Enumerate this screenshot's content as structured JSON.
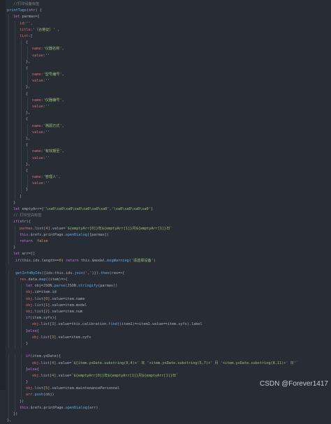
{
  "colors": {
    "background": "#282c34",
    "comment": "#7f848e",
    "keyword": "#c678dd",
    "string": "#98c379",
    "function": "#61afef",
    "property": "#e06c75",
    "number": "#d19a66",
    "plain": "#abb2bf",
    "class": "#e5c07b"
  },
  "code_lines": [
    {
      "indent": 1,
      "segments": [
        {
          "t": "//打印设备标签",
          "c": "comment"
        }
      ]
    },
    {
      "indent": 0,
      "segments": [
        {
          "t": "printTags",
          "c": "function"
        },
        {
          "t": "(str) {",
          "c": "plain"
        }
      ]
    },
    {
      "indent": 1,
      "segments": [
        {
          "t": "let",
          "c": "keyword"
        },
        {
          "t": " parmas={",
          "c": "plain"
        }
      ]
    },
    {
      "indent": 2,
      "segments": [
        {
          "t": "id",
          "c": "property"
        },
        {
          "t": ":",
          "c": "plain"
        },
        {
          "t": "''",
          "c": "string"
        },
        {
          "t": ",",
          "c": "plain"
        }
      ]
    },
    {
      "indent": 2,
      "segments": [
        {
          "t": "title",
          "c": "property"
        },
        {
          "t": ":",
          "c": "plain"
        },
        {
          "t": "'（合格证）'",
          "c": "string"
        },
        {
          "t": " ,",
          "c": "plain"
        }
      ]
    },
    {
      "indent": 2,
      "segments": [
        {
          "t": "list",
          "c": "property"
        },
        {
          "t": ":[",
          "c": "plain"
        }
      ]
    },
    {
      "indent": 3,
      "segments": [
        {
          "t": "{",
          "c": "plain"
        }
      ]
    },
    {
      "indent": 4,
      "segments": [
        {
          "t": "name",
          "c": "property"
        },
        {
          "t": ":",
          "c": "plain"
        },
        {
          "t": "'仪器名称'",
          "c": "string"
        },
        {
          "t": ",",
          "c": "plain"
        }
      ]
    },
    {
      "indent": 4,
      "segments": [
        {
          "t": "value",
          "c": "property"
        },
        {
          "t": ":",
          "c": "plain"
        },
        {
          "t": "''",
          "c": "string"
        }
      ]
    },
    {
      "indent": 3,
      "segments": [
        {
          "t": "},",
          "c": "plain"
        }
      ]
    },
    {
      "indent": 3,
      "segments": [
        {
          "t": "{",
          "c": "plain"
        }
      ]
    },
    {
      "indent": 4,
      "segments": [
        {
          "t": "name",
          "c": "property"
        },
        {
          "t": ":",
          "c": "plain"
        },
        {
          "t": "'型号编号'",
          "c": "string"
        },
        {
          "t": ",",
          "c": "plain"
        }
      ]
    },
    {
      "indent": 4,
      "segments": [
        {
          "t": "value",
          "c": "property"
        },
        {
          "t": ":",
          "c": "plain"
        },
        {
          "t": "''",
          "c": "string"
        }
      ]
    },
    {
      "indent": 3,
      "segments": [
        {
          "t": "},",
          "c": "plain"
        }
      ]
    },
    {
      "indent": 3,
      "segments": [
        {
          "t": "{",
          "c": "plain"
        }
      ]
    },
    {
      "indent": 4,
      "segments": [
        {
          "t": "name",
          "c": "property"
        },
        {
          "t": ":",
          "c": "plain"
        },
        {
          "t": "'仪器编号'",
          "c": "string"
        },
        {
          "t": ",",
          "c": "plain"
        }
      ]
    },
    {
      "indent": 4,
      "segments": [
        {
          "t": "value",
          "c": "property"
        },
        {
          "t": ":",
          "c": "plain"
        },
        {
          "t": "''",
          "c": "string"
        }
      ]
    },
    {
      "indent": 3,
      "segments": [
        {
          "t": "},",
          "c": "plain"
        }
      ]
    },
    {
      "indent": 3,
      "segments": [
        {
          "t": "{",
          "c": "plain"
        }
      ]
    },
    {
      "indent": 4,
      "segments": [
        {
          "t": "name",
          "c": "property"
        },
        {
          "t": ":",
          "c": "plain"
        },
        {
          "t": "'溯源方式'",
          "c": "string"
        },
        {
          "t": ",",
          "c": "plain"
        }
      ]
    },
    {
      "indent": 4,
      "segments": [
        {
          "t": "value",
          "c": "property"
        },
        {
          "t": ":",
          "c": "plain"
        },
        {
          "t": "''",
          "c": "string"
        }
      ]
    },
    {
      "indent": 3,
      "segments": [
        {
          "t": "},",
          "c": "plain"
        }
      ]
    },
    {
      "indent": 3,
      "segments": [
        {
          "t": "{",
          "c": "plain"
        }
      ]
    },
    {
      "indent": 4,
      "segments": [
        {
          "t": "name",
          "c": "property"
        },
        {
          "t": ":",
          "c": "plain"
        },
        {
          "t": "'有效期至'",
          "c": "string"
        },
        {
          "t": ",",
          "c": "plain"
        }
      ]
    },
    {
      "indent": 4,
      "segments": [
        {
          "t": "value",
          "c": "property"
        },
        {
          "t": ":",
          "c": "plain"
        },
        {
          "t": "''",
          "c": "string"
        }
      ]
    },
    {
      "indent": 3,
      "segments": [
        {
          "t": "},",
          "c": "plain"
        }
      ]
    },
    {
      "indent": 3,
      "segments": [
        {
          "t": "{",
          "c": "plain"
        }
      ]
    },
    {
      "indent": 4,
      "segments": [
        {
          "t": "name",
          "c": "property"
        },
        {
          "t": ":",
          "c": "plain"
        },
        {
          "t": "'管理人'",
          "c": "string"
        },
        {
          "t": ",",
          "c": "plain"
        }
      ]
    },
    {
      "indent": 4,
      "segments": [
        {
          "t": "value",
          "c": "property"
        },
        {
          "t": ":",
          "c": "plain"
        },
        {
          "t": "''",
          "c": "string"
        }
      ]
    },
    {
      "indent": 3,
      "segments": [
        {
          "t": "}",
          "c": "plain"
        }
      ]
    },
    {
      "indent": 2,
      "segments": [
        {
          "t": "]",
          "c": "plain"
        }
      ]
    },
    {
      "indent": 1,
      "segments": [
        {
          "t": "}",
          "c": "plain"
        }
      ]
    },
    {
      "indent": 1,
      "segments": [
        {
          "t": "let",
          "c": "keyword"
        },
        {
          "t": " emptyArr=[",
          "c": "plain"
        },
        {
          "t": "'\\xa0\\xa0\\xa0\\xa0\\xa0\\xa0\\xa0'",
          "c": "string"
        },
        {
          "t": ",",
          "c": "plain"
        },
        {
          "t": "'\\xa0\\xa0\\xa0\\xa0'",
          "c": "string"
        },
        {
          "t": "]",
          "c": "plain"
        }
      ]
    },
    {
      "indent": 1,
      "segments": [
        {
          "t": "// 打印空白标签",
          "c": "comment"
        }
      ]
    },
    {
      "indent": 1,
      "segments": [
        {
          "t": "if",
          "c": "keyword"
        },
        {
          "t": "(str){",
          "c": "plain"
        }
      ]
    },
    {
      "indent": 2,
      "segments": [
        {
          "t": "parmas",
          "c": "property"
        },
        {
          "t": ".list[",
          "c": "plain"
        },
        {
          "t": "4",
          "c": "number"
        },
        {
          "t": "].value=",
          "c": "plain"
        },
        {
          "t": "`${emptyArr[0]}年${emptyArr[1]}月${emptyArr[1]}日`",
          "c": "string"
        }
      ]
    },
    {
      "indent": 2,
      "segments": [
        {
          "t": "this",
          "c": "keyword"
        },
        {
          "t": ".$refs.printPage.",
          "c": "plain"
        },
        {
          "t": "openDialog",
          "c": "function"
        },
        {
          "t": "([parmas])",
          "c": "plain"
        }
      ]
    },
    {
      "indent": 2,
      "segments": [
        {
          "t": "return",
          "c": "keyword"
        },
        {
          "t": "  ",
          "c": "plain"
        },
        {
          "t": "false",
          "c": "number"
        }
      ]
    },
    {
      "indent": 1,
      "segments": [
        {
          "t": "}",
          "c": "plain"
        }
      ]
    },
    {
      "indent": 1,
      "segments": [
        {
          "t": "let",
          "c": "keyword"
        },
        {
          "t": " arr=[]",
          "c": "plain"
        }
      ]
    },
    {
      "indent": 1,
      "segments": [
        {
          "t": " if",
          "c": "keyword"
        },
        {
          "t": "(this.ids.length==",
          "c": "plain"
        },
        {
          "t": "0",
          "c": "number"
        },
        {
          "t": ") ",
          "c": "plain"
        },
        {
          "t": "return",
          "c": "keyword"
        },
        {
          "t": " this.$modal.",
          "c": "plain"
        },
        {
          "t": "msgWarning",
          "c": "function"
        },
        {
          "t": "(",
          "c": "plain"
        },
        {
          "t": "'请选择设备'",
          "c": "string"
        },
        {
          "t": ")",
          "c": "plain"
        }
      ]
    },
    {
      "indent": 0,
      "segments": [
        {
          "t": " ",
          "c": "plain"
        }
      ]
    },
    {
      "indent": 1,
      "segments": [
        {
          "t": " getInfoByIds",
          "c": "function"
        },
        {
          "t": "({ids:this.ids.",
          "c": "plain"
        },
        {
          "t": "join",
          "c": "function"
        },
        {
          "t": "(',')}).",
          "c": "plain"
        },
        {
          "t": "then",
          "c": "function"
        },
        {
          "t": "(res=>{",
          "c": "plain"
        }
      ]
    },
    {
      "indent": 2,
      "segments": [
        {
          "t": "res",
          "c": "property"
        },
        {
          "t": ".data.",
          "c": "plain"
        },
        {
          "t": "map",
          "c": "function"
        },
        {
          "t": "((item)=>{",
          "c": "plain"
        }
      ]
    },
    {
      "indent": 3,
      "segments": [
        {
          "t": "let",
          "c": "keyword"
        },
        {
          "t": " obj=JSON.",
          "c": "plain"
        },
        {
          "t": "parse",
          "c": "function"
        },
        {
          "t": "(JSON.",
          "c": "plain"
        },
        {
          "t": "stringify",
          "c": "function"
        },
        {
          "t": "(parmas))",
          "c": "plain"
        }
      ]
    },
    {
      "indent": 3,
      "segments": [
        {
          "t": "obj",
          "c": "property"
        },
        {
          "t": ".id=item.id",
          "c": "plain"
        }
      ]
    },
    {
      "indent": 3,
      "segments": [
        {
          "t": "obj",
          "c": "property"
        },
        {
          "t": ".list[",
          "c": "plain"
        },
        {
          "t": "0",
          "c": "number"
        },
        {
          "t": "].value=item.name",
          "c": "plain"
        }
      ]
    },
    {
      "indent": 3,
      "segments": [
        {
          "t": "obj",
          "c": "property"
        },
        {
          "t": ".list[",
          "c": "plain"
        },
        {
          "t": "1",
          "c": "number"
        },
        {
          "t": "].value=item.model",
          "c": "plain"
        }
      ]
    },
    {
      "indent": 3,
      "segments": [
        {
          "t": "obj",
          "c": "property"
        },
        {
          "t": ".list[",
          "c": "plain"
        },
        {
          "t": "2",
          "c": "number"
        },
        {
          "t": "].value=item.num",
          "c": "plain"
        }
      ]
    },
    {
      "indent": 3,
      "segments": [
        {
          "t": "if",
          "c": "keyword"
        },
        {
          "t": "(item.syfs){",
          "c": "plain"
        }
      ]
    },
    {
      "indent": 4,
      "segments": [
        {
          "t": "obj",
          "c": "property"
        },
        {
          "t": ".list[",
          "c": "plain"
        },
        {
          "t": "3",
          "c": "number"
        },
        {
          "t": "].value=this.calibration.",
          "c": "plain"
        },
        {
          "t": "find",
          "c": "function"
        },
        {
          "t": "((item1)=>item1.value==item.syfs).label",
          "c": "plain"
        }
      ]
    },
    {
      "indent": 3,
      "segments": [
        {
          "t": "}",
          "c": "plain"
        },
        {
          "t": "else",
          "c": "keyword"
        },
        {
          "t": "{",
          "c": "plain"
        }
      ]
    },
    {
      "indent": 4,
      "segments": [
        {
          "t": "obj",
          "c": "property"
        },
        {
          "t": ".list[",
          "c": "plain"
        },
        {
          "t": "3",
          "c": "number"
        },
        {
          "t": "].value=item.syfs",
          "c": "plain"
        }
      ]
    },
    {
      "indent": 3,
      "segments": [
        {
          "t": "}",
          "c": "plain"
        }
      ]
    },
    {
      "indent": 0,
      "segments": [
        {
          "t": " ",
          "c": "plain"
        }
      ]
    },
    {
      "indent": 3,
      "segments": [
        {
          "t": "if",
          "c": "keyword"
        },
        {
          "t": "(item.yxDate){",
          "c": "plain"
        }
      ]
    },
    {
      "indent": 4,
      "segments": [
        {
          "t": "obj",
          "c": "property"
        },
        {
          "t": ".list[",
          "c": "plain"
        },
        {
          "t": "4",
          "c": "number"
        },
        {
          "t": "].value=",
          "c": "plain"
        },
        {
          "t": "`${item.yxDate.substring(0,4)+' 年 '+item.yxDate.substring(5,7)+' 月 '+item.yxDate.substring(8,11)+' 日'`",
          "c": "string"
        }
      ]
    },
    {
      "indent": 3,
      "segments": [
        {
          "t": "}",
          "c": "plain"
        },
        {
          "t": "else",
          "c": "keyword"
        },
        {
          "t": "{",
          "c": "plain"
        }
      ]
    },
    {
      "indent": 4,
      "segments": [
        {
          "t": "obj",
          "c": "property"
        },
        {
          "t": ".list[",
          "c": "plain"
        },
        {
          "t": "4",
          "c": "number"
        },
        {
          "t": "].value=",
          "c": "plain"
        },
        {
          "t": "`${emptyArr[0]}年${emptyArr[1]}月${emptyArr[1]}日`",
          "c": "string"
        }
      ]
    },
    {
      "indent": 3,
      "segments": [
        {
          "t": "}",
          "c": "plain"
        }
      ]
    },
    {
      "indent": 3,
      "segments": [
        {
          "t": "obj",
          "c": "property"
        },
        {
          "t": ".list[",
          "c": "plain"
        },
        {
          "t": "5",
          "c": "number"
        },
        {
          "t": "].value=item.maintenancePersonnel",
          "c": "plain"
        }
      ]
    },
    {
      "indent": 3,
      "segments": [
        {
          "t": "arr",
          "c": "property"
        },
        {
          "t": ".",
          "c": "plain"
        },
        {
          "t": "push",
          "c": "function"
        },
        {
          "t": "(obj)",
          "c": "plain"
        }
      ]
    },
    {
      "indent": 2,
      "segments": [
        {
          "t": "})",
          "c": "plain"
        }
      ]
    },
    {
      "indent": 2,
      "segments": [
        {
          "t": "this",
          "c": "keyword"
        },
        {
          "t": ".$refs.printPage.",
          "c": "plain"
        },
        {
          "t": "openDialog",
          "c": "function"
        },
        {
          "t": "(arr)",
          "c": "plain"
        }
      ]
    },
    {
      "indent": 1,
      "segments": [
        {
          "t": "})",
          "c": "plain"
        }
      ]
    },
    {
      "indent": 0,
      "segments": [
        {
          "t": "},",
          "c": "plain"
        }
      ]
    }
  ],
  "watermark": {
    "text": "CSDN @Forever1417"
  }
}
